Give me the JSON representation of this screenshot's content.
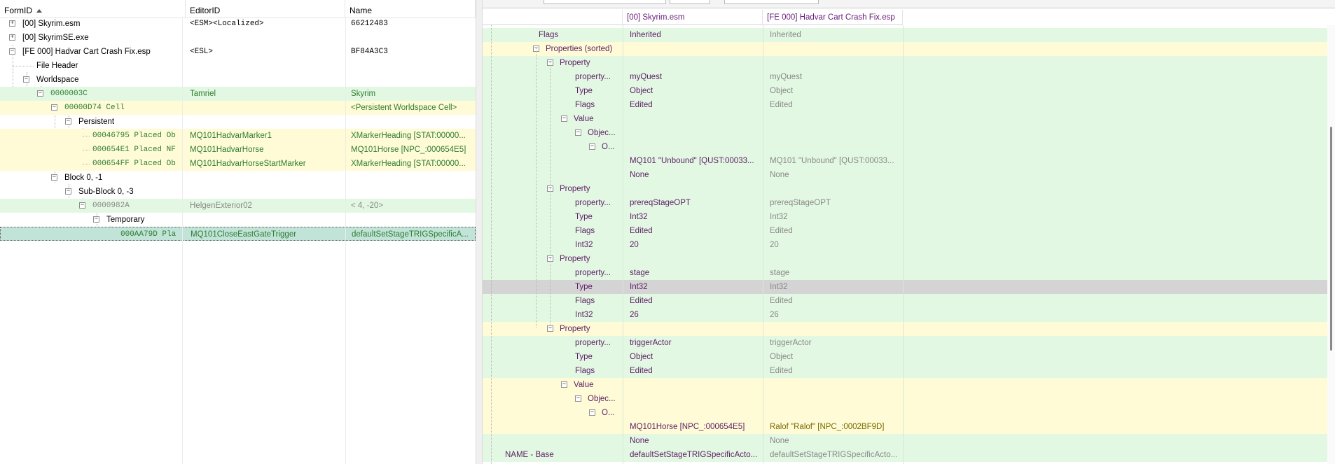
{
  "left": {
    "columns": {
      "formid": "FormID",
      "editorid": "EditorID",
      "name": "Name"
    },
    "rows": [
      {
        "formid": "[00] Skyrim.esm",
        "editorid": "<ESM><Localized>",
        "name": "66212483",
        "toggle": "+"
      },
      {
        "formid": "[00] SkyrimSE.exe",
        "editorid": "",
        "name": "",
        "toggle": "+"
      },
      {
        "formid": "[FE 000] Hadvar Cart Crash Fix.esp",
        "editorid": "<ESL>",
        "name": "BF84A3C3",
        "toggle": "−"
      },
      {
        "formid": "File Header",
        "editorid": "",
        "name": "",
        "toggle": ""
      },
      {
        "formid": "Worldspace",
        "editorid": "",
        "name": "",
        "toggle": "−"
      },
      {
        "formid": "0000003C",
        "editorid": "Tamriel",
        "name": "Skyrim",
        "toggle": "−"
      },
      {
        "formid": "00000D74  Cell",
        "editorid": "",
        "name": "<Persistent Worldspace Cell>",
        "toggle": "−"
      },
      {
        "formid": "Persistent",
        "editorid": "",
        "name": "",
        "toggle": "−"
      },
      {
        "formid": "00046795  Placed Ob",
        "editorid": "MQ101HadvarMarker1",
        "name": "XMarkerHeading [STAT:00000...",
        "toggle": ""
      },
      {
        "formid": "000654E1  Placed NF",
        "editorid": "MQ101HadvarHorse",
        "name": "MQ101Horse [NPC_:000654E5]",
        "toggle": ""
      },
      {
        "formid": "000654FF  Placed Ob",
        "editorid": "MQ101HadvarHorseStartMarker",
        "name": "XMarkerHeading [STAT:00000...",
        "toggle": ""
      },
      {
        "formid": "Block 0, -1",
        "editorid": "",
        "name": "",
        "toggle": "−"
      },
      {
        "formid": "Sub-Block 0, -3",
        "editorid": "",
        "name": "",
        "toggle": "−"
      },
      {
        "formid": "0000982A",
        "editorid": "HelgenExterior02",
        "name": "<  4, -20>",
        "toggle": "−"
      },
      {
        "formid": "Temporary",
        "editorid": "",
        "name": "",
        "toggle": "−"
      },
      {
        "formid": "000AA79D  Pla",
        "editorid": "MQ101CloseEastGateTrigger",
        "name": "defaultSetStageTRIGSpecificA...",
        "toggle": ""
      }
    ]
  },
  "right": {
    "columns": {
      "col1": "[00] Skyrim.esm",
      "col2": "[FE 000] Hadvar Cart Crash Fix.esp"
    },
    "rows": [
      {
        "label": "Flags",
        "v1": "Inherited",
        "v2": "Inherited",
        "toggle": ""
      },
      {
        "label": "Properties (sorted)",
        "v1": "",
        "v2": "",
        "toggle": "−"
      },
      {
        "label": "Property",
        "v1": "",
        "v2": "",
        "toggle": "−"
      },
      {
        "label": "property...",
        "v1": "myQuest",
        "v2": "myQuest",
        "toggle": ""
      },
      {
        "label": "Type",
        "v1": "Object",
        "v2": "Object",
        "toggle": ""
      },
      {
        "label": "Flags",
        "v1": "Edited",
        "v2": "Edited",
        "toggle": ""
      },
      {
        "label": "Value",
        "v1": "",
        "v2": "",
        "toggle": "−"
      },
      {
        "label": "Objec...",
        "v1": "",
        "v2": "",
        "toggle": "−"
      },
      {
        "label": "O...",
        "v1": "",
        "v2": "",
        "toggle": "−"
      },
      {
        "label": "",
        "v1": "MQ101 \"Unbound\" [QUST:00033...",
        "v2": "MQ101 \"Unbound\" [QUST:00033...",
        "toggle": ""
      },
      {
        "label": "",
        "v1": "None",
        "v2": "None",
        "toggle": ""
      },
      {
        "label": "Property",
        "v1": "",
        "v2": "",
        "toggle": "−"
      },
      {
        "label": "property...",
        "v1": "prereqStageOPT",
        "v2": "prereqStageOPT",
        "toggle": ""
      },
      {
        "label": "Type",
        "v1": "Int32",
        "v2": "Int32",
        "toggle": ""
      },
      {
        "label": "Flags",
        "v1": "Edited",
        "v2": "Edited",
        "toggle": ""
      },
      {
        "label": "Int32",
        "v1": "20",
        "v2": "20",
        "toggle": ""
      },
      {
        "label": "Property",
        "v1": "",
        "v2": "",
        "toggle": "−"
      },
      {
        "label": "property...",
        "v1": "stage",
        "v2": "stage",
        "toggle": ""
      },
      {
        "label": "Type",
        "v1": "Int32",
        "v2": "Int32",
        "toggle": ""
      },
      {
        "label": "Flags",
        "v1": "Edited",
        "v2": "Edited",
        "toggle": ""
      },
      {
        "label": "Int32",
        "v1": "26",
        "v2": "26",
        "toggle": ""
      },
      {
        "label": "Property",
        "v1": "",
        "v2": "",
        "toggle": "−"
      },
      {
        "label": "property...",
        "v1": "triggerActor",
        "v2": "triggerActor",
        "toggle": ""
      },
      {
        "label": "Type",
        "v1": "Object",
        "v2": "Object",
        "toggle": ""
      },
      {
        "label": "Flags",
        "v1": "Edited",
        "v2": "Edited",
        "toggle": ""
      },
      {
        "label": "Value",
        "v1": "",
        "v2": "",
        "toggle": "−"
      },
      {
        "label": "Objec...",
        "v1": "",
        "v2": "",
        "toggle": "−"
      },
      {
        "label": "O...",
        "v1": "",
        "v2": "",
        "toggle": "−"
      },
      {
        "label": "",
        "v1": "MQ101Horse [NPC_:000654E5]",
        "v2": "Ralof \"Ralof\" [NPC_:0002BF9D]",
        "toggle": ""
      },
      {
        "label": "",
        "v1": "None",
        "v2": "None",
        "toggle": ""
      },
      {
        "label": "NAME - Base",
        "v1": "defaultSetStageTRIGSpecificActo...",
        "v2": "defaultSetStageTRIGSpecificActo...",
        "toggle": ""
      }
    ]
  },
  "colors": {
    "green_row": "#e3f8e3",
    "yellow_row": "#fffbd6",
    "selected_row": "#c2e3d8",
    "header_purple": "#6a1b7a"
  }
}
